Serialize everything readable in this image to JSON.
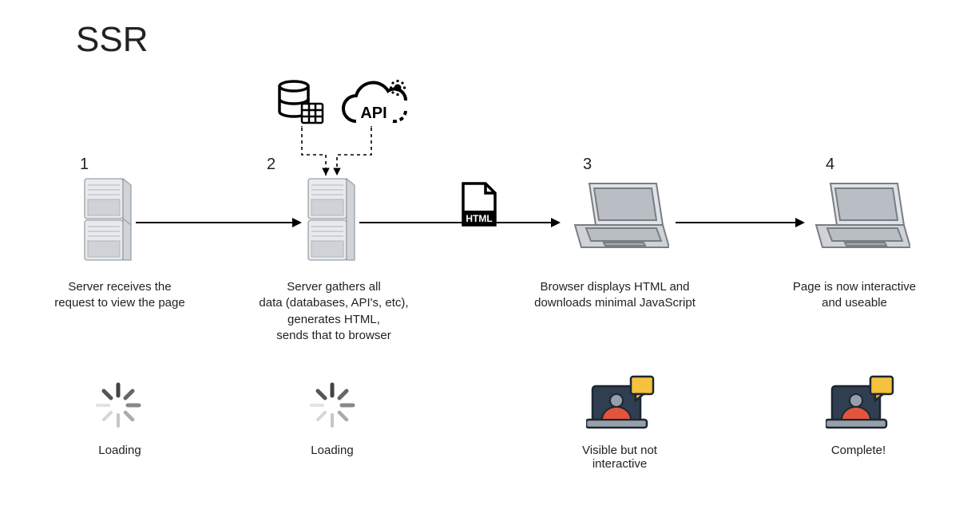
{
  "title": "SSR",
  "steps": [
    {
      "num": "1",
      "desc": "Server receives the\nrequest to view the page",
      "status": "Loading"
    },
    {
      "num": "2",
      "desc": "Server gathers all\ndata (databases, API's, etc),\ngenerates HTML,\nsends that to browser",
      "status": "Loading"
    },
    {
      "num": "3",
      "desc": "Browser displays HTML and\ndownloads minimal JavaScript",
      "status": "Visible but not\ninteractive"
    },
    {
      "num": "4",
      "desc": "Page is now interactive\nand useable",
      "status": "Complete!"
    }
  ],
  "icons": {
    "api_label": "API",
    "html_label": "HTML"
  }
}
